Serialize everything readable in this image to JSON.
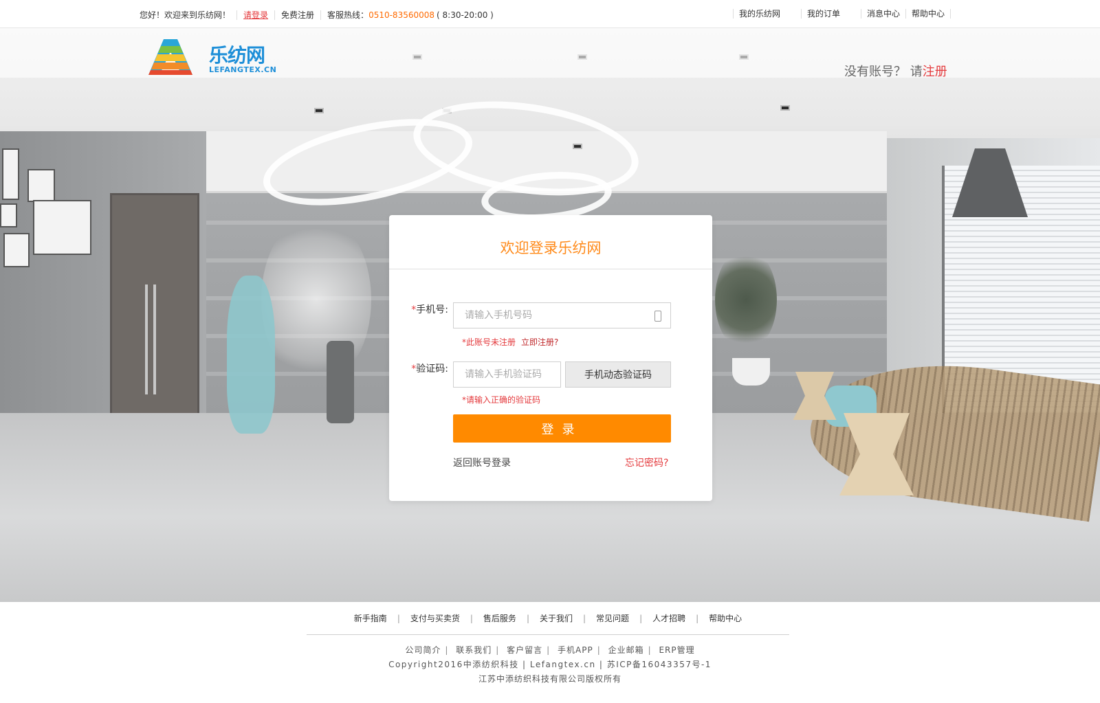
{
  "topbar": {
    "welcome": "您好！欢迎来到乐纺网！",
    "login": "请登录",
    "register": "免费注册",
    "hotline_label": "客服热线：",
    "hotline_number": "0510-83560008",
    "hotline_hours": "( 8:30-20:00 )",
    "right_items": [
      "我的乐纺网",
      "我的订单",
      "消息中心",
      "帮助中心"
    ]
  },
  "header": {
    "logo_cn": "乐纺网",
    "logo_en": "LEFANGTEX.CN",
    "no_account": "没有账号？ 请",
    "register_link": "注册"
  },
  "login_card": {
    "title": "欢迎登录乐纺网",
    "phone_label_req": "*",
    "phone_label": "手机号:",
    "phone_placeholder": "请输入手机号码",
    "phone_error": "*此账号未注册",
    "phone_error_link": "立即注册?",
    "code_label_req": "*",
    "code_label": "验证码:",
    "code_placeholder": "请输入手机验证码",
    "code_button": "手机动态验证码",
    "code_error": "*请输入正确的验证码",
    "login_button": "登录",
    "back_link": "返回账号登录",
    "forgot_link": "忘记密码?"
  },
  "footer": {
    "nav": [
      "新手指南",
      "支付与买卖货",
      "售后服务",
      "关于我们",
      "常见问题",
      "人才招聘",
      "帮助中心"
    ],
    "links": [
      "公司简介",
      "联系我们",
      "客户留言",
      "手机APP",
      "企业邮箱",
      "ERP管理"
    ],
    "copyright": "Copyright2016中添纺织科技 | Lefangtex.cn | 苏ICP备16043357号-1",
    "owner": "江苏中添纺织科技有限公司版权所有"
  },
  "colors": {
    "accent_orange": "#ff8a00",
    "link_red": "#e4393c",
    "brand_blue": "#1e8fd8"
  }
}
